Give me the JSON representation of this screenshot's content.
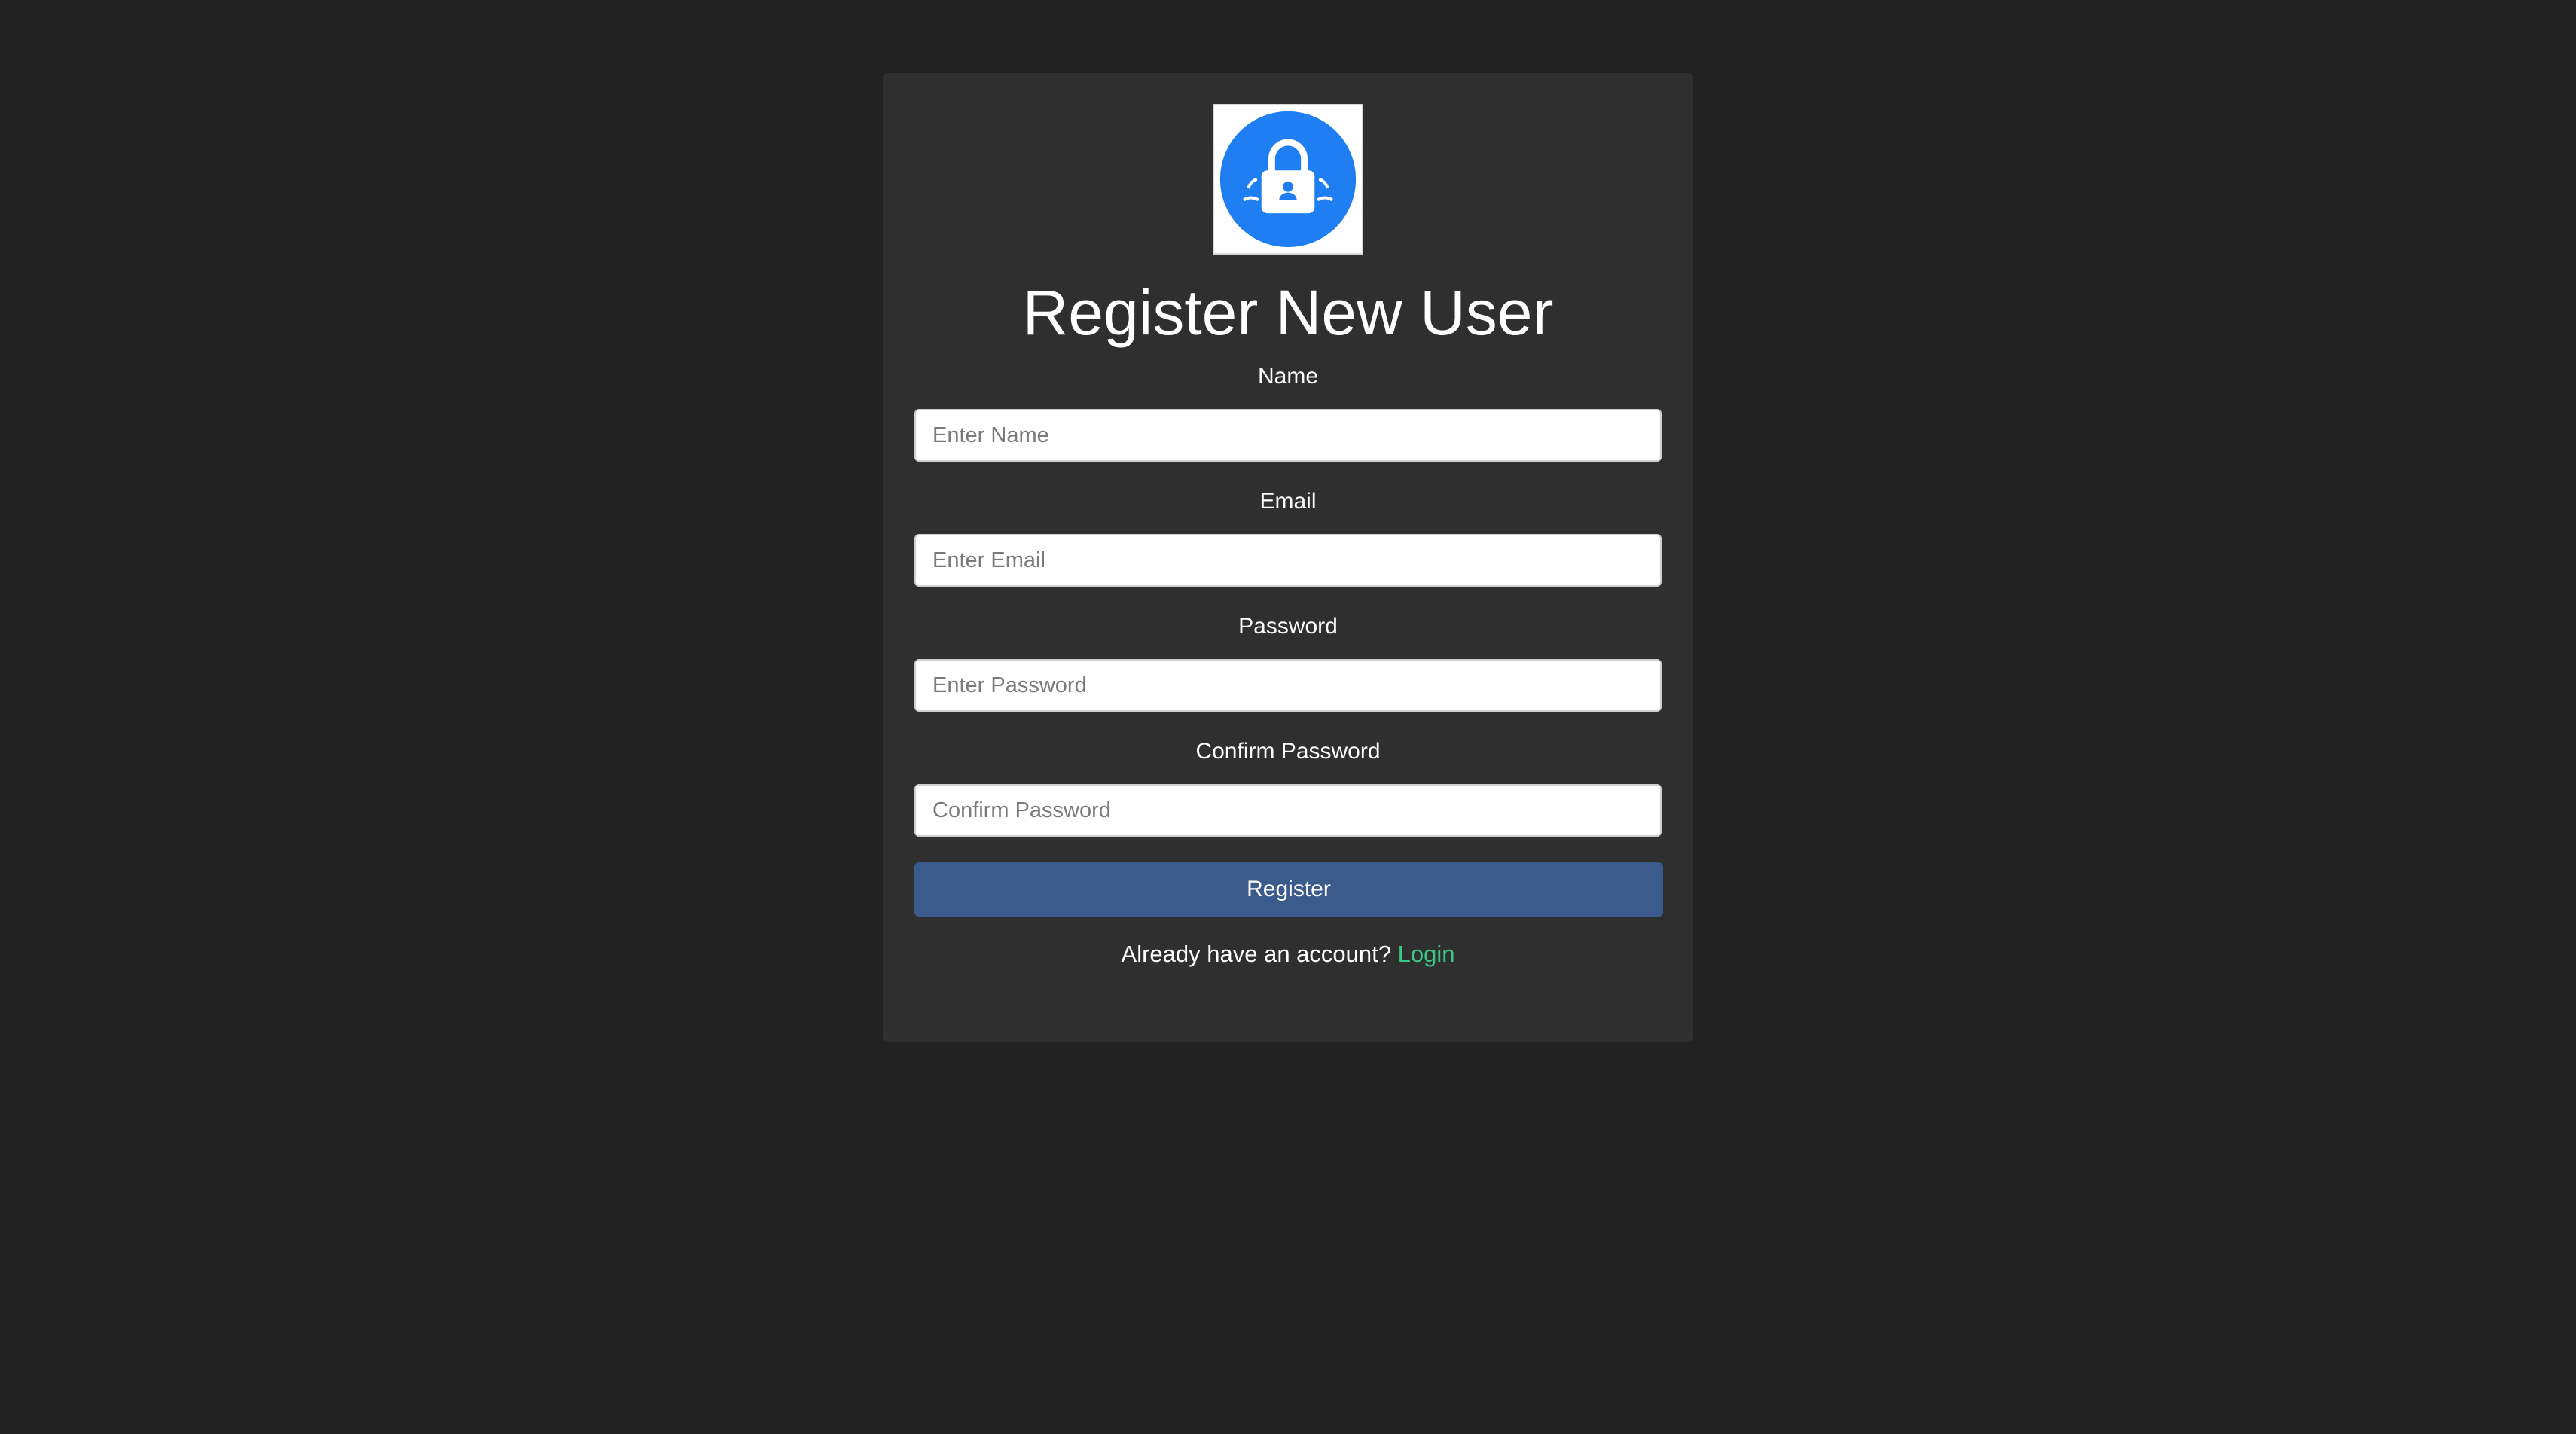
{
  "page": {
    "title": "Register New User"
  },
  "logo": {
    "icon": "lock-shield-icon",
    "colors": {
      "circle": "#1f7ef2",
      "lock": "#ffffff"
    }
  },
  "form": {
    "fields": [
      {
        "label": "Name",
        "placeholder": "Enter Name",
        "value": ""
      },
      {
        "label": "Email",
        "placeholder": "Enter Email",
        "value": ""
      },
      {
        "label": "Password",
        "placeholder": "Enter Password",
        "value": ""
      },
      {
        "label": "Confirm Password",
        "placeholder": "Confirm Password",
        "value": ""
      }
    ],
    "submit_label": "Register"
  },
  "footer": {
    "prompt": "Already have an account?",
    "link_label": "Login"
  },
  "colors": {
    "background": "#222222",
    "card": "#2f2f2f",
    "button": "#3b5b8d",
    "link": "#3cc78a"
  }
}
